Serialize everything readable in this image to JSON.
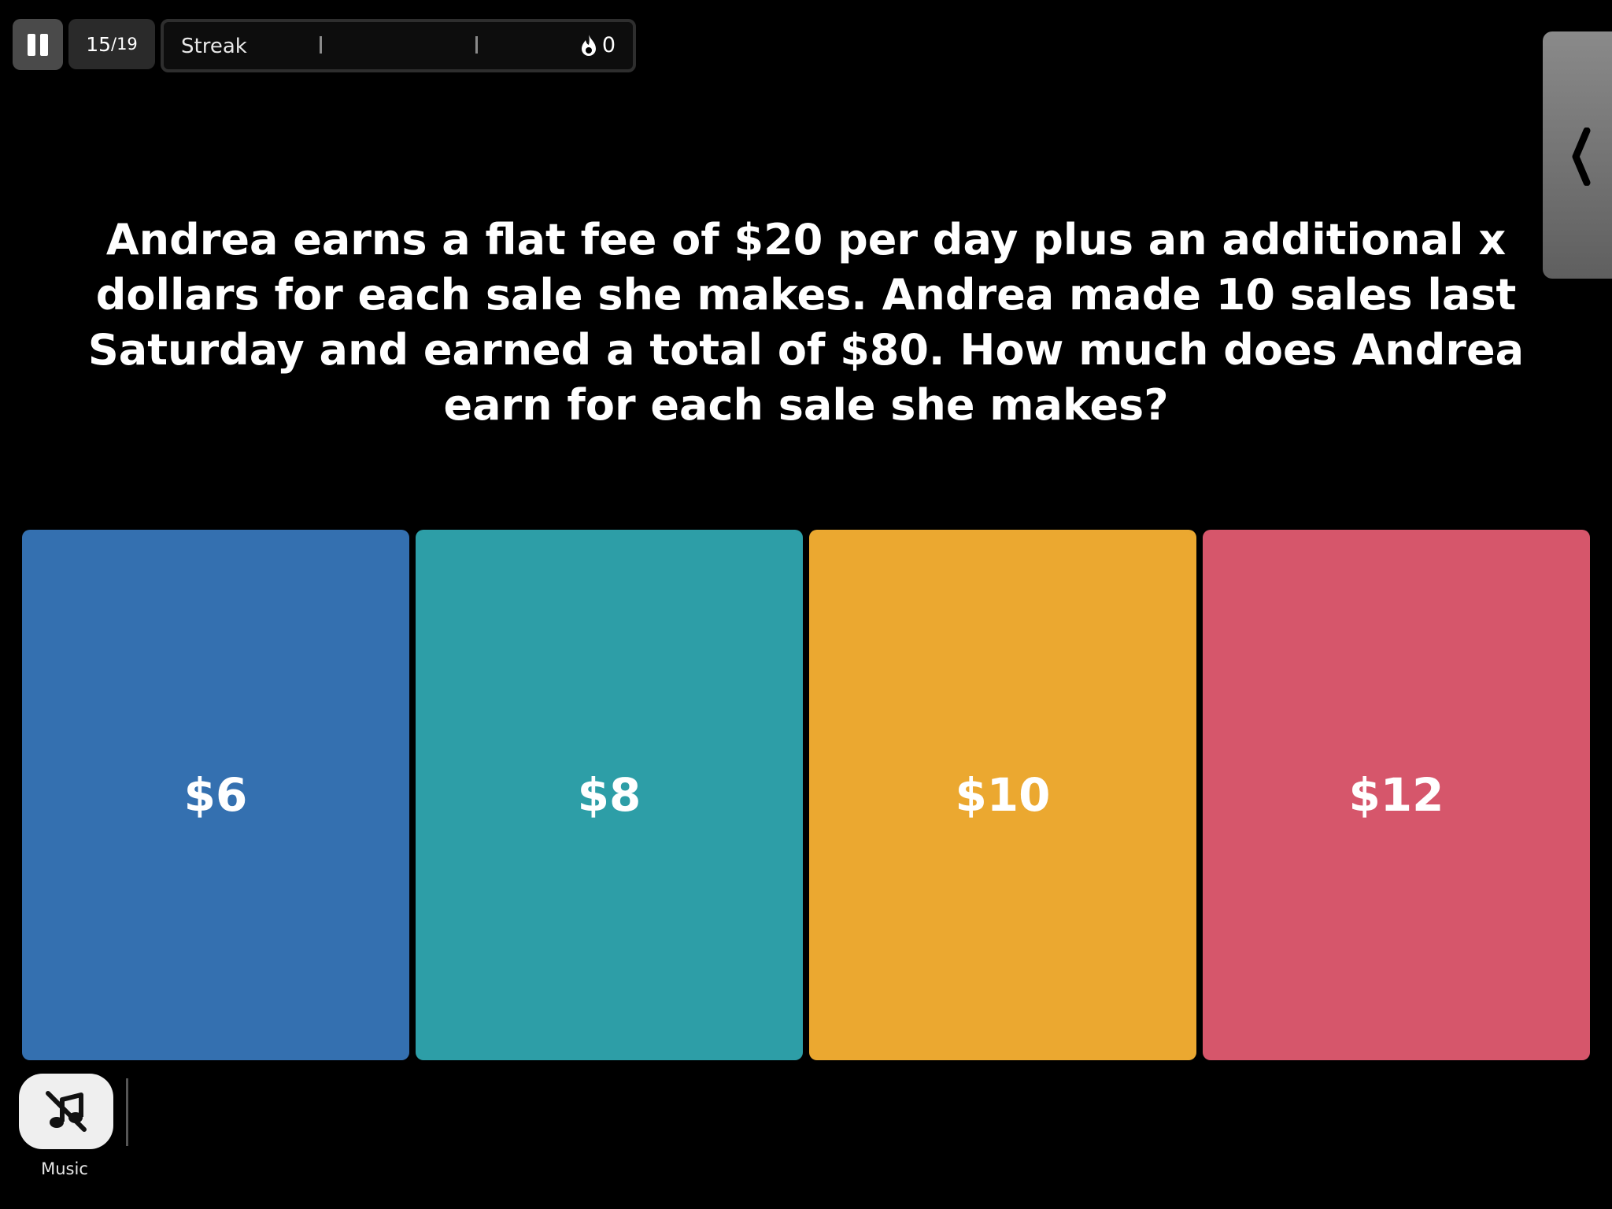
{
  "header": {
    "question_current": "15",
    "question_total": "/19",
    "streak_label": "Streak",
    "streak_count": "0",
    "streak_icon": "flame-icon",
    "pause_icon": "pause-icon"
  },
  "side_panel": {
    "icon": "chevron-left-icon"
  },
  "question": {
    "text": "Andrea earns a flat fee of $20 per day plus an additional x dollars for each sale she makes. Andrea made 10 sales last Saturday and earned a total of $80. How much does Andrea earn for each sale she makes?"
  },
  "answers": [
    {
      "label": "$6",
      "color": "#3470b0"
    },
    {
      "label": "$8",
      "color": "#2d9ea7"
    },
    {
      "label": "$10",
      "color": "#eba830"
    },
    {
      "label": "$12",
      "color": "#d6566b"
    }
  ],
  "footer": {
    "music_label": "Music",
    "music_icon": "music-muted-icon"
  }
}
